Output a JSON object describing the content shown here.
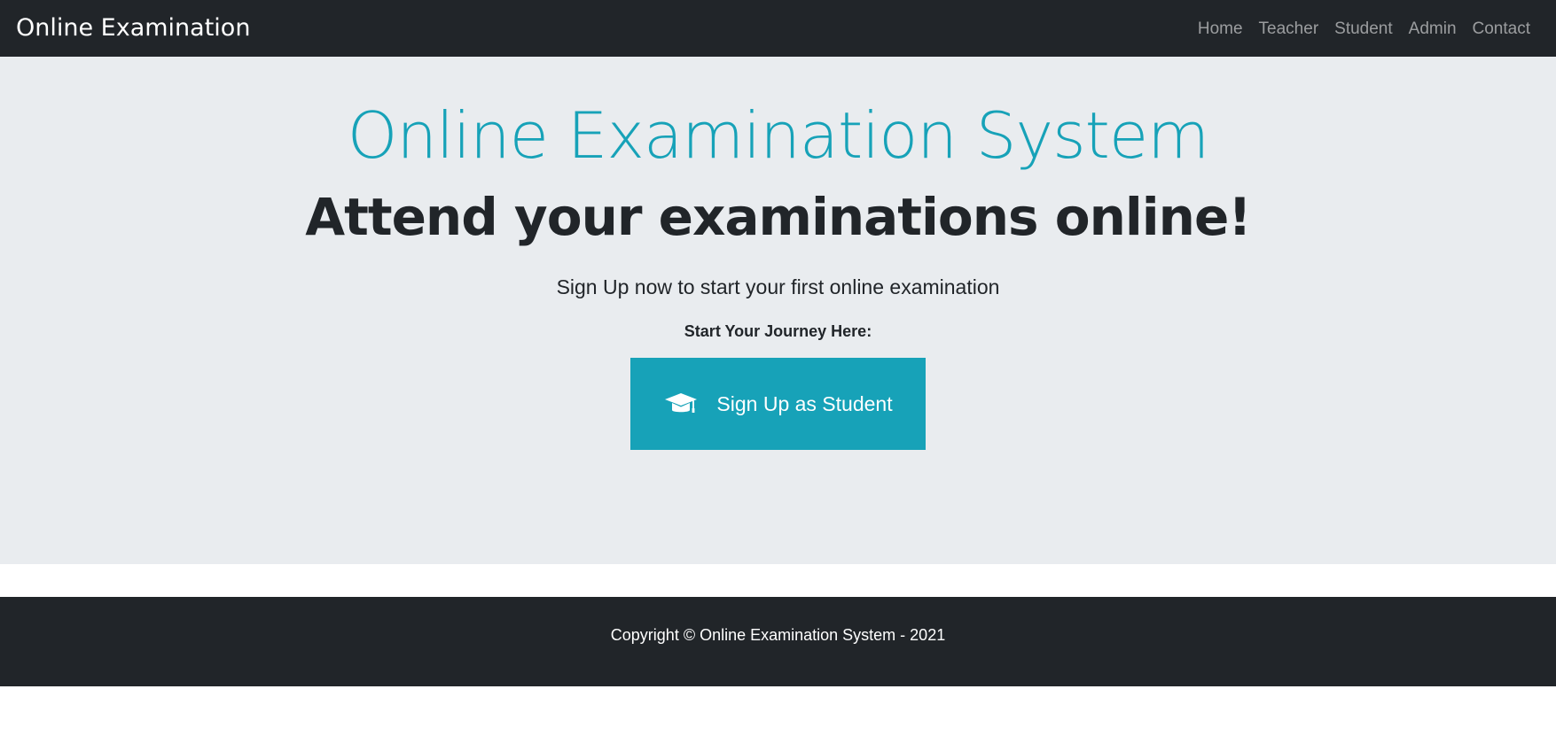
{
  "navbar": {
    "brand": "Online Examination",
    "links": [
      {
        "label": "Home"
      },
      {
        "label": "Teacher"
      },
      {
        "label": "Student"
      },
      {
        "label": "Admin"
      },
      {
        "label": "Contact"
      }
    ]
  },
  "hero": {
    "title": "Online Examination System",
    "subtitle": "Attend your examinations online!",
    "lead": "Sign Up now to start your first online examination",
    "journey_label": "Start Your Journey Here:",
    "signup_button": {
      "label": "Sign Up as Student",
      "icon": "graduation-cap-icon"
    }
  },
  "footer": {
    "copyright": "Copyright © Online Examination System - 2021"
  },
  "colors": {
    "navbar_bg": "#212529",
    "hero_bg": "#e9ecef",
    "accent": "#17a2b8",
    "text": "#212529"
  }
}
